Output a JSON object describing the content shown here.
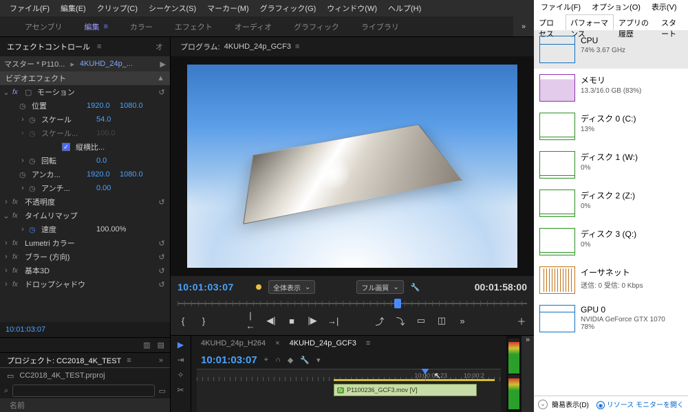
{
  "premiere": {
    "menu": [
      "ファイル(F)",
      "編集(E)",
      "クリップ(C)",
      "シーケンス(S)",
      "マーカー(M)",
      "グラフィック(G)",
      "ウィンドウ(W)",
      "ヘルプ(H)"
    ],
    "workspace_tabs": [
      "アセンブリ",
      "編集",
      "カラー",
      "エフェクト",
      "オーディオ",
      "グラフィック",
      "ライブラリ"
    ],
    "workspace_active": "編集",
    "effect_controls": {
      "title": "エフェクトコントロール",
      "master": "マスター * P110...",
      "seq": "4KUHD_24p_...",
      "section": "ビデオエフェクト",
      "rows": {
        "motion": "モーション",
        "position": "位置",
        "position_x": "1920.0",
        "position_y": "1080.0",
        "scale": "スケール",
        "scale_v": "54.0",
        "scale_w": "スケール...",
        "scale_w_v": "100.0",
        "aspect": "縦横比...",
        "rotation": "回転",
        "rotation_v": "0.0",
        "anchor": "アンカ...",
        "anchor_x": "1920.0",
        "anchor_y": "1080.0",
        "antiflicker": "アンチ...",
        "antiflicker_v": "0.00",
        "opacity": "不透明度",
        "timeremap": "タイムリマップ",
        "speed": "速度",
        "speed_v": "100.00%",
        "lumetri": "Lumetri カラー",
        "blur": "ブラー (方向)",
        "basic3d": "基本3D",
        "dropshadow": "ドロップシャドウ"
      },
      "timecode": "10:01:03:07"
    },
    "project": {
      "title": "プロジェクト: CC2018_4K_TEST",
      "file": "CC2018_4K_TEST.prproj",
      "search_placeholder": "",
      "col_name": "名前"
    },
    "program": {
      "label": "プログラム:",
      "seq": "4KUHD_24p_GCF3",
      "tc_left": "10:01:03:07",
      "fit": "全体表示",
      "quality": "フル画質",
      "tc_right": "00:01:58:00"
    },
    "timeline": {
      "tabs": [
        "4KUHD_24p_H264",
        "4KUHD_24p_GCF3"
      ],
      "active_tab": 1,
      "timecode": "10:01:03:07",
      "ruler_t1": "10:00:08:23",
      "ruler_t2": "10:00:2",
      "clip": "P1100236_GCF3.mov [V]"
    }
  },
  "taskmgr": {
    "menu": [
      "ファイル(F)",
      "オプション(O)",
      "表示(V)"
    ],
    "tabs": [
      "プロセス",
      "パフォーマンス",
      "アプリの履歴",
      "スタート"
    ],
    "active_tab": 1,
    "items": [
      {
        "name": "CPU",
        "sub": "74%  3.67 GHz",
        "kind": "cpu",
        "selected": true
      },
      {
        "name": "メモリ",
        "sub": "13.3/16.0 GB (83%)",
        "kind": "mem"
      },
      {
        "name": "ディスク 0 (C:)",
        "sub": "13%",
        "kind": "disk"
      },
      {
        "name": "ディスク 1 (W:)",
        "sub": "0%",
        "kind": "disk"
      },
      {
        "name": "ディスク 2 (Z:)",
        "sub": "0%",
        "kind": "disk"
      },
      {
        "name": "ディスク 3 (Q:)",
        "sub": "0%",
        "kind": "disk"
      },
      {
        "name": "イーサネット",
        "sub": "送信: 0 受信: 0 Kbps",
        "kind": "net"
      },
      {
        "name": "GPU 0",
        "sub": "NVIDIA GeForce GTX 1070\n78%",
        "kind": "gpu"
      }
    ],
    "footer": {
      "brief": "簡易表示(D)",
      "resmon": "リソース モニターを開く"
    }
  }
}
